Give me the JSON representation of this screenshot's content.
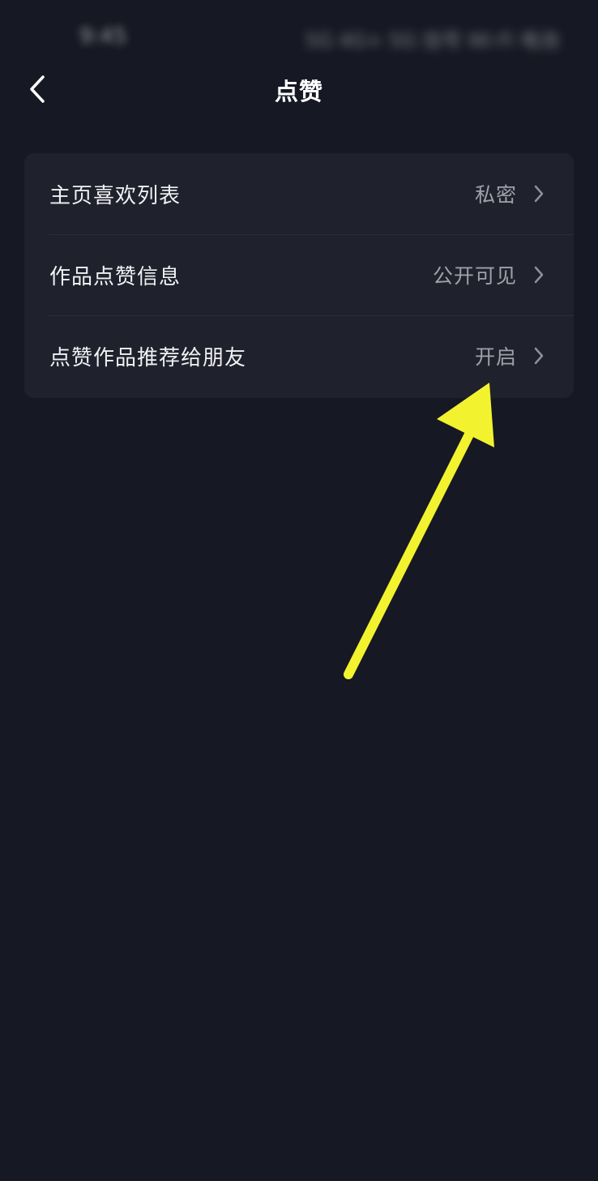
{
  "status_bar": {
    "time": "9:45",
    "indicators": "5G 4G+ 5G 信号 Wi-Fi 电池"
  },
  "nav": {
    "back_icon": "chevron-left-icon",
    "title": "点赞"
  },
  "settings": {
    "rows": [
      {
        "label": "主页喜欢列表",
        "value": "私密",
        "chevron_icon": "chevron-right-icon"
      },
      {
        "label": "作品点赞信息",
        "value": "公开可见",
        "chevron_icon": "chevron-right-icon"
      },
      {
        "label": "点赞作品推荐给朋友",
        "value": "开启",
        "chevron_icon": "chevron-right-icon"
      }
    ]
  },
  "annotation": {
    "type": "arrow",
    "color": "#f2f32e",
    "points_to": "点赞作品推荐给朋友"
  },
  "colors": {
    "background": "#161823",
    "card": "#1f212d",
    "text_primary": "#f1f1f3",
    "text_secondary": "#a0a1a8"
  }
}
